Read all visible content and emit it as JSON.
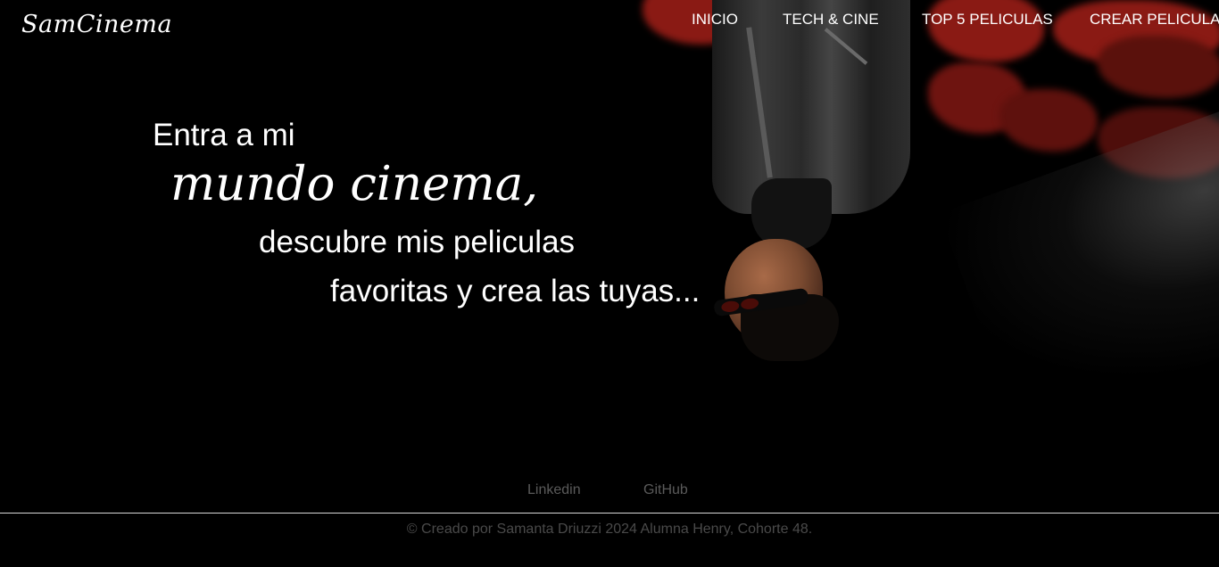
{
  "header": {
    "logo": "SamCinema",
    "nav": [
      {
        "label": "INICIO"
      },
      {
        "label": "TECH & CINE"
      },
      {
        "label": "TOP 5 PELICULAS"
      },
      {
        "label": "CREAR PELICULA"
      }
    ]
  },
  "hero": {
    "line1": "Entra a mi",
    "line2": "mundo cinema,",
    "line3": "descubre mis peliculas",
    "line4": "favoritas y crea las tuyas..."
  },
  "footer": {
    "links": [
      {
        "label": "Linkedin"
      },
      {
        "label": "GitHub"
      }
    ],
    "copyright": "© Creado por Samanta Driuzzi 2024 Alumna Henry, Cohorte 48."
  },
  "colors": {
    "background": "#000000",
    "text": "#ffffff",
    "footer_text": "#5a5a5a",
    "accent_red": "#8a1a14"
  }
}
